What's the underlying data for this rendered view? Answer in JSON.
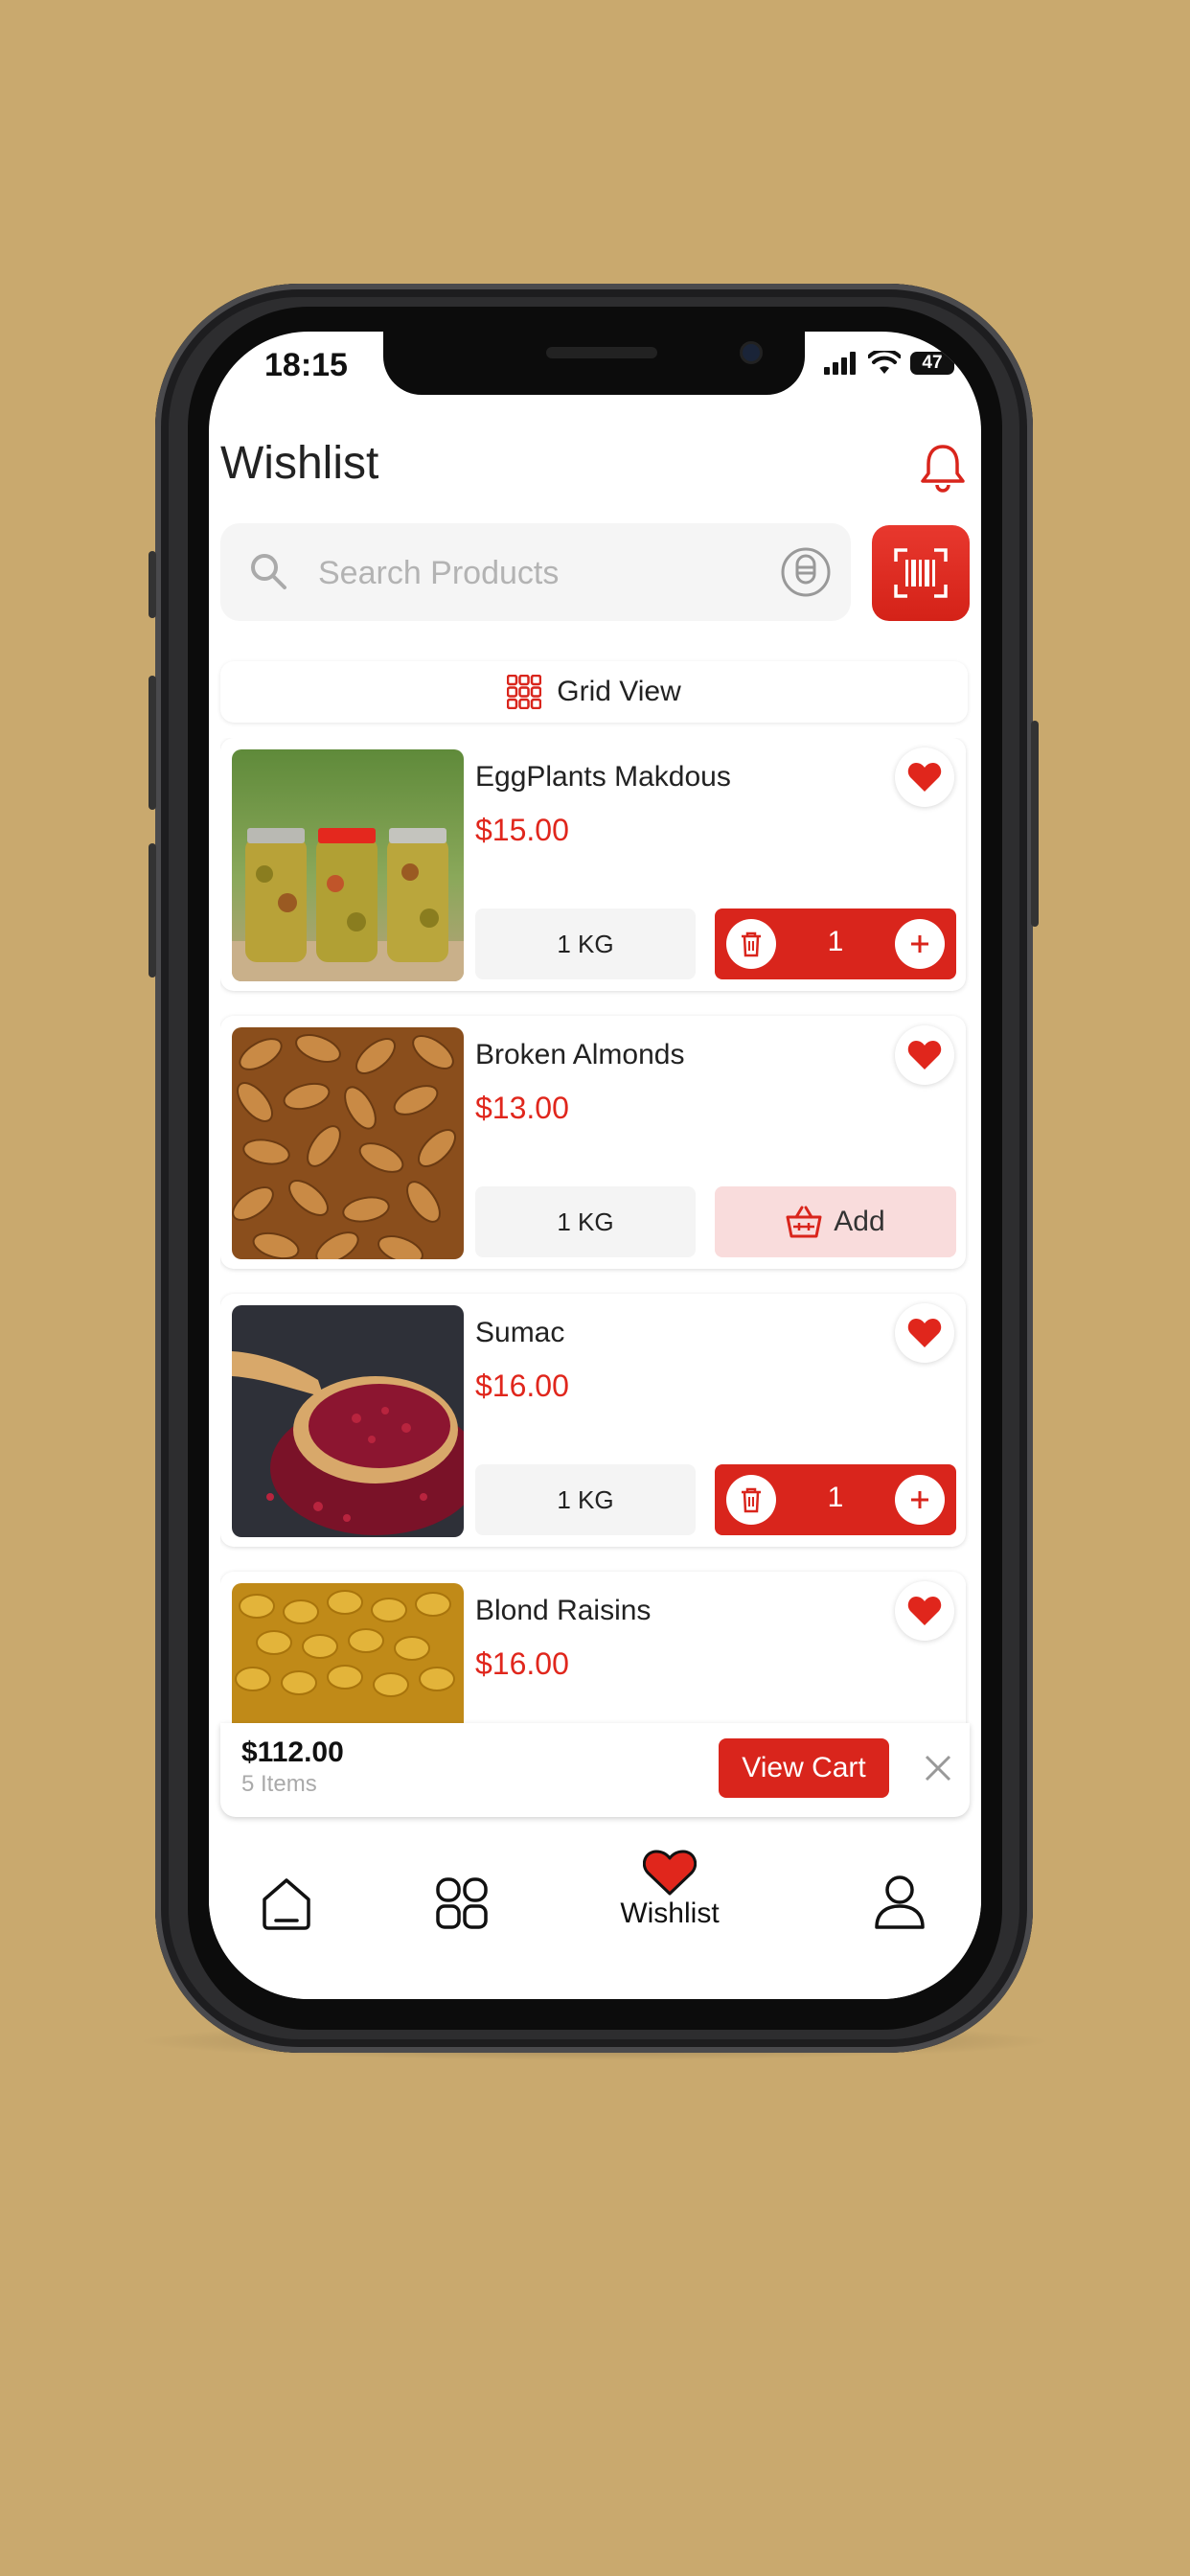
{
  "status_bar": {
    "time": "18:15",
    "battery": "47"
  },
  "header": {
    "title": "Wishlist"
  },
  "search": {
    "placeholder": "Search Products"
  },
  "view_toggle": {
    "label": "Grid View"
  },
  "products": [
    {
      "name": "EggPlants Makdous",
      "price": "$15.00",
      "unit": "1 KG",
      "in_cart": true,
      "quantity": "1"
    },
    {
      "name": "Broken Almonds",
      "price": "$13.00",
      "unit": "1 KG",
      "in_cart": false,
      "add_label": "Add"
    },
    {
      "name": "Sumac",
      "price": "$16.00",
      "unit": "1 KG",
      "in_cart": true,
      "quantity": "1"
    },
    {
      "name": "Blond Raisins",
      "price": "$16.00"
    }
  ],
  "cart_bar": {
    "total": "$112.00",
    "items": "5 Items",
    "button": "View Cart"
  },
  "tabbar": {
    "active": "Wishlist",
    "active_label": "Wishlist"
  },
  "colors": {
    "accent": "#d9251c",
    "background": "#c9a96e",
    "add_bg": "#f9dcdc"
  },
  "icons": [
    "bell-icon",
    "search-icon",
    "microphone-icon",
    "barcode-scan-icon",
    "grid-icon",
    "heart-icon",
    "trash-icon",
    "plus-icon",
    "basket-icon",
    "close-icon",
    "home-icon",
    "categories-icon",
    "user-icon"
  ]
}
